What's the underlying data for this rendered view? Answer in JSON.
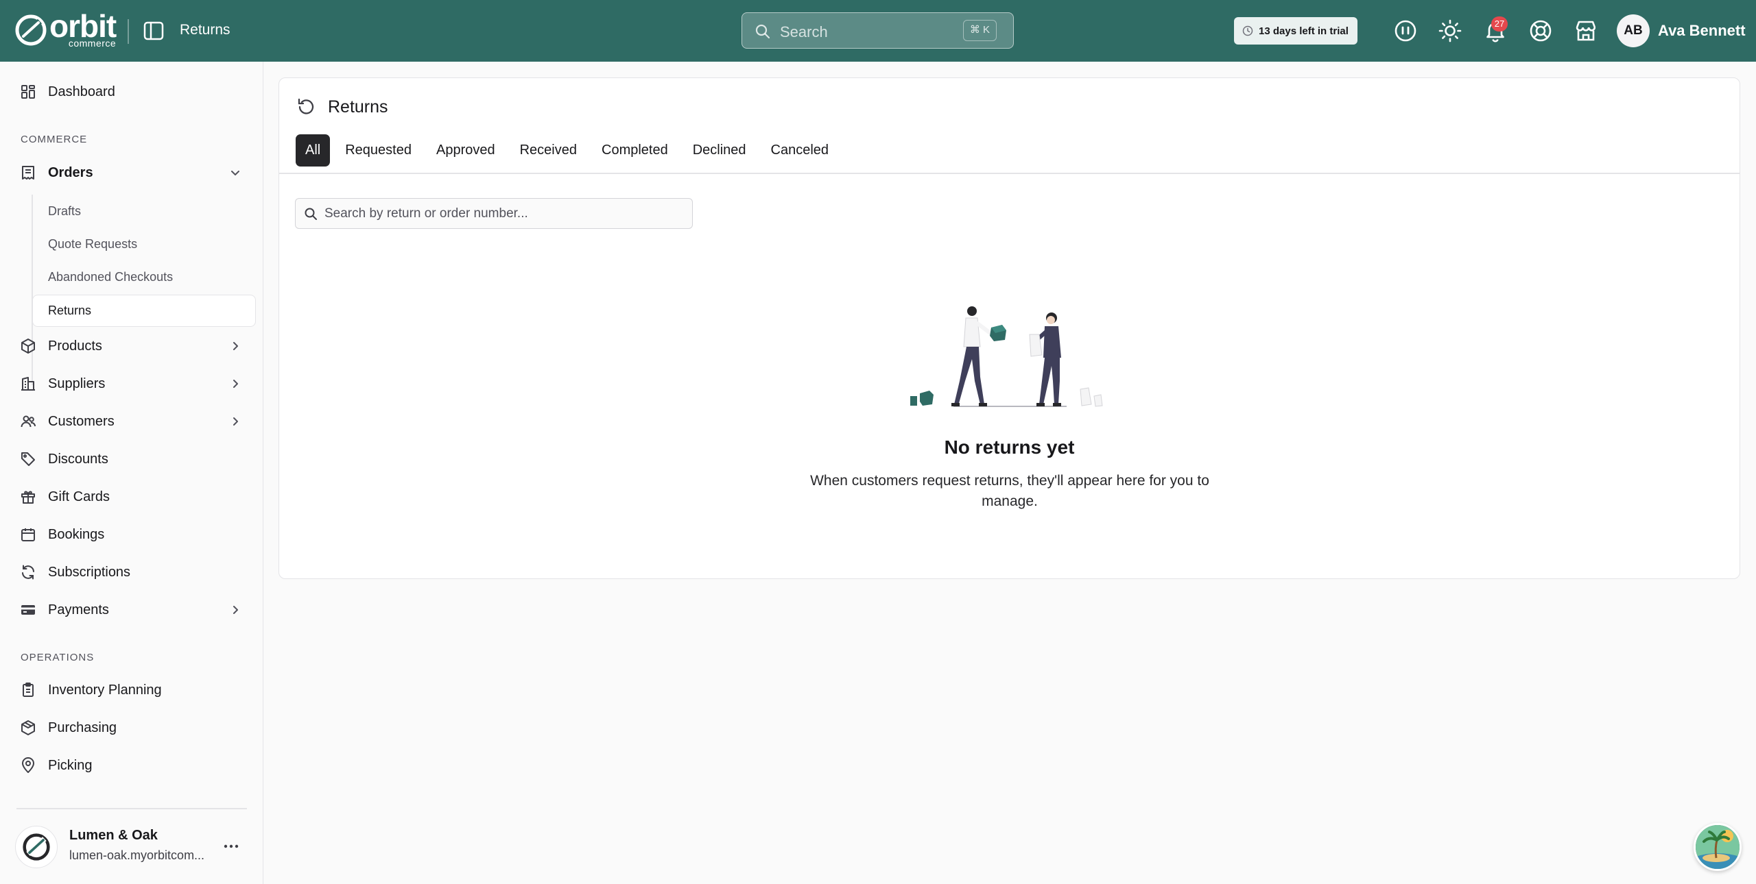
{
  "app": {
    "brand": "orbit",
    "brand_sub": "commerce",
    "page_title": "Returns"
  },
  "topbar": {
    "search_placeholder": "Search",
    "search_shortcut": "⌘ K",
    "trial_text": "13 days left in trial",
    "notification_count": "27",
    "user_initials": "AB",
    "user_name": "Ava Bennett"
  },
  "sidebar": {
    "dashboard": "Dashboard",
    "section_commerce": "COMMERCE",
    "orders": "Orders",
    "orders_sub": [
      "Drafts",
      "Quote Requests",
      "Abandoned Checkouts",
      "Returns"
    ],
    "products": "Products",
    "suppliers": "Suppliers",
    "customers": "Customers",
    "discounts": "Discounts",
    "gift_cards": "Gift Cards",
    "bookings": "Bookings",
    "subscriptions": "Subscriptions",
    "payments": "Payments",
    "section_operations": "OPERATIONS",
    "inventory_planning": "Inventory Planning",
    "purchasing": "Purchasing",
    "picking": "Picking",
    "store_name": "Lumen & Oak",
    "store_url": "lumen-oak.myorbitcom..."
  },
  "main": {
    "title": "Returns",
    "tabs": [
      "All",
      "Requested",
      "Approved",
      "Received",
      "Completed",
      "Declined",
      "Canceled"
    ],
    "active_tab": "All",
    "search_placeholder": "Search by return or order number...",
    "empty_title": "No returns yet",
    "empty_desc": "When customers request returns, they'll appear here for you to manage."
  },
  "colors": {
    "topbar": "#2f6b64",
    "accent_dark": "#27272a",
    "badge": "#e5484d"
  }
}
